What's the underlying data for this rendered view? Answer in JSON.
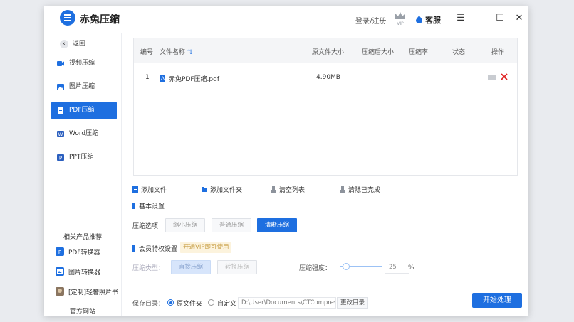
{
  "app": {
    "title": "赤兔压缩",
    "login": "登录/注册",
    "vip_badge": "VIP",
    "service": "客服"
  },
  "window_controls": {
    "menu": "☰",
    "minimize": "—",
    "maximize": "☐",
    "close": "✕"
  },
  "sidebar": {
    "back": "返回",
    "items": [
      {
        "label": "视频压缩",
        "icon": "video-icon"
      },
      {
        "label": "图片压缩",
        "icon": "image-icon"
      },
      {
        "label": "PDF压缩",
        "icon": "pdf-icon",
        "active": true
      },
      {
        "label": "Word压缩",
        "icon": "word-icon"
      },
      {
        "label": "PPT压缩",
        "icon": "ppt-icon"
      }
    ],
    "recommend_title": "相关产品推荐",
    "recommend": [
      {
        "label": "PDF转换器",
        "icon": "pdf-converter-icon"
      },
      {
        "label": "图片转换器",
        "icon": "image-converter-icon"
      },
      {
        "label": "[定制]轻奢照片书",
        "icon": "photobook-icon"
      }
    ],
    "official_site": "官方网站"
  },
  "table": {
    "headers": [
      "编号",
      "文件名称",
      "原文件大小",
      "压缩后大小",
      "压缩率",
      "状态",
      "操作"
    ],
    "rows": [
      {
        "index": "1",
        "name": "赤兔PDF压缩.pdf",
        "orig_size": "4.90MB",
        "comp_size": "",
        "ratio": "",
        "status": ""
      }
    ]
  },
  "toolbar": {
    "add_file": "添加文件",
    "add_folder": "添加文件夹",
    "clear_list": "清空列表",
    "clear_done": "清除已完成"
  },
  "basic": {
    "title": "基本设置",
    "option_label": "压缩选项",
    "options": [
      "缩小压缩",
      "普通压缩",
      "清晰压缩"
    ],
    "selected": "清晰压缩"
  },
  "vip": {
    "title": "会员特权设置",
    "tag": "开通VIP即可使用",
    "type_label": "压缩类型：",
    "types": [
      "直接压缩",
      "转换压缩"
    ],
    "strength_label": "压缩强度：",
    "strength_value": "25",
    "strength_unit": "%",
    "strength_level": 0.25
  },
  "save": {
    "label": "保存目录：",
    "option_original": "原文件夹",
    "option_custom": "自定义",
    "selected": "原文件夹",
    "path": "D:\\User\\Documents\\CTCompres",
    "change_button": "更改目录"
  },
  "start_button": "开始处理",
  "colors": {
    "accent": "#1e6fe0",
    "delete": "#e02020",
    "vip_tag_bg": "#fcf3dd",
    "vip_tag_text": "#c9a14a"
  }
}
